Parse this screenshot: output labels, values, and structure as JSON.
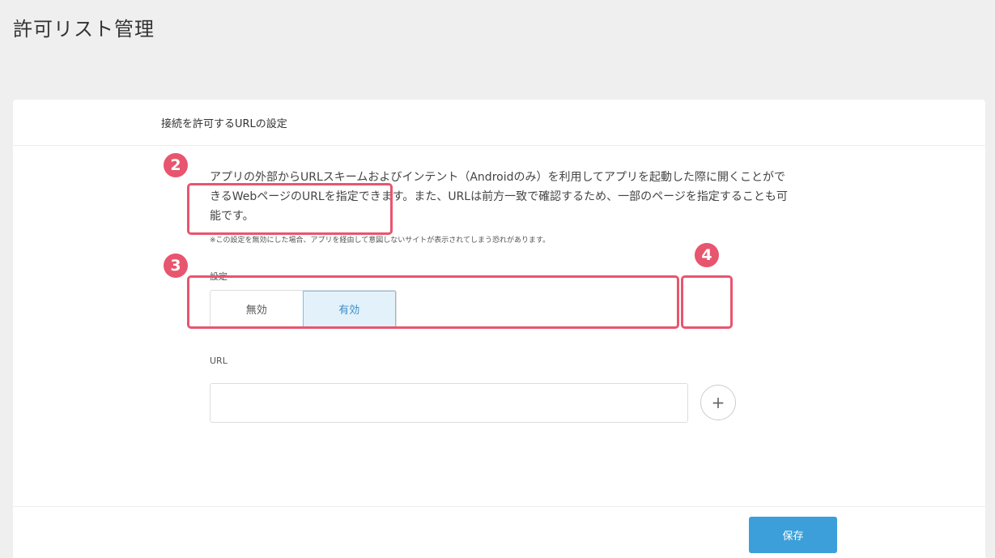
{
  "page": {
    "title": "許可リスト管理"
  },
  "card": {
    "title": "接続を許可するURLの設定",
    "description": "アプリの外部からURLスキームおよびインテント（Androidのみ）を利用してアプリを起動した際に開くことができるWebページのURLを指定できます。また、URLは前方一致で確認するため、一部のページを指定することも可能です。",
    "note": "※この設定を無効にした場合、アプリを経由して意図しないサイトが表示されてしまう恐れがあります。"
  },
  "setting": {
    "label": "設定",
    "options": [
      "無効",
      "有効"
    ],
    "selected": "有効"
  },
  "url": {
    "label": "URL",
    "value": "",
    "add_label": "+"
  },
  "footer": {
    "save_label": "保存"
  },
  "annotations": {
    "badge_2": "2",
    "badge_3": "3",
    "badge_4": "4"
  },
  "colors": {
    "accent": "#3d9fd9",
    "highlight": "#e8556e",
    "active_bg": "#e3f1fb"
  }
}
